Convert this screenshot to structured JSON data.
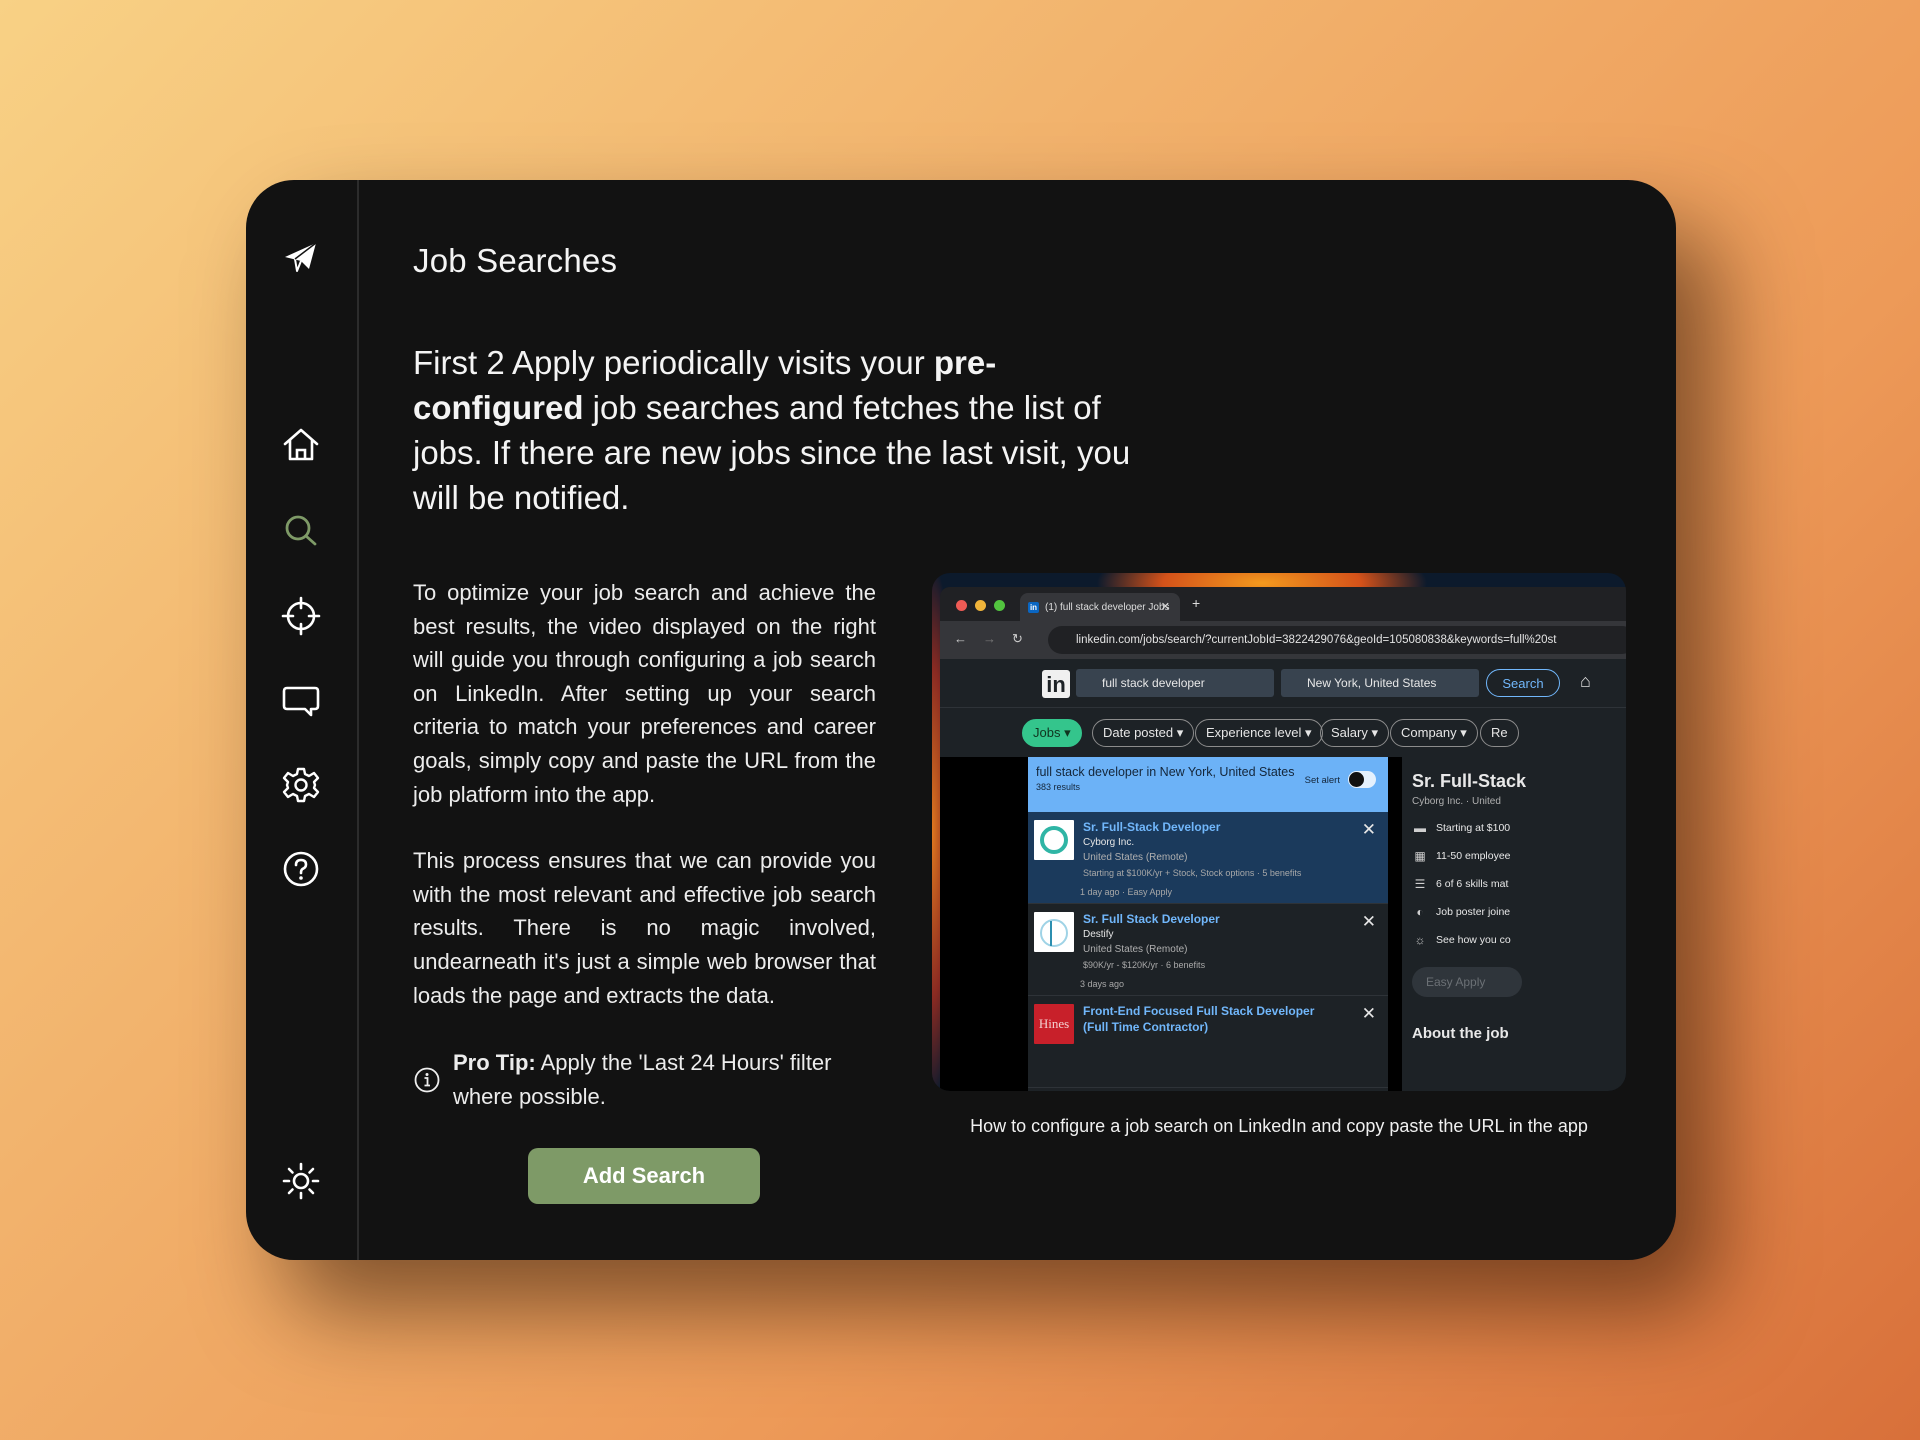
{
  "app": {
    "sidebar": {
      "logo_icon": "paper-plane-icon",
      "items": [
        {
          "name": "home",
          "icon": "home-icon",
          "active": false
        },
        {
          "name": "search",
          "icon": "search-icon",
          "active": true
        },
        {
          "name": "targets",
          "icon": "crosshair-icon",
          "active": false
        },
        {
          "name": "feedback",
          "icon": "chat-bubble-icon",
          "active": false
        },
        {
          "name": "settings",
          "icon": "gear-icon",
          "active": false
        },
        {
          "name": "help",
          "icon": "help-circle-icon",
          "active": false
        }
      ],
      "theme_toggle_icon": "sun-icon"
    },
    "colors": {
      "accent": "#7e9a67",
      "window_bg": "#121212",
      "text": "#f2f2f2"
    }
  },
  "page": {
    "title": "Job Searches",
    "lead": {
      "part1": "First 2 Apply periodically visits your ",
      "bold": "pre-configured",
      "part2": " job searches and fetches the list of jobs. If there are new jobs since the last visit, you will be notified."
    },
    "paragraphs": [
      "To optimize your job search and achieve the best results, the video displayed on the right will guide you through configuring a job search on LinkedIn. After setting up your search criteria to match your preferences and career goals, simply copy and paste the URL from the job platform into the app.",
      "This process ensures that we can provide you with the most relevant and effective job search results. There is no magic involved, undearneath it's just a simple web browser that loads the page and extracts the data."
    ],
    "tip": {
      "icon": "info-icon",
      "label": "Pro Tip:",
      "text": " Apply the 'Last 24 Hours' filter where possible."
    },
    "add_button": "Add Search",
    "video": {
      "caption": "How to configure a job search on LinkedIn and copy paste the URL in the app",
      "browser": {
        "tab_title": "(1) full stack developer Jobs",
        "url": "linkedin.com/jobs/search/?currentJobId=3822429076&geoId=105080838&keywords=full%20st"
      },
      "linkedin": {
        "search_value": "full stack developer",
        "location_value": "New York, United States",
        "search_button": "Search",
        "filters": [
          "Jobs",
          "Date posted",
          "Experience level",
          "Salary",
          "Company",
          "Re"
        ],
        "results_query": "full stack developer in New York, United States",
        "results_count": "383 results",
        "set_alert": "Set alert",
        "jobs": [
          {
            "title": "Sr. Full-Stack Developer",
            "company": "Cyborg Inc.",
            "location": "United States (Remote)",
            "salary": "Starting at $100K/yr + Stock, Stock options · 5 benefits",
            "meta": "1 day ago · Easy Apply"
          },
          {
            "title": "Sr. Full Stack Developer",
            "company": "Destify",
            "location": "United States (Remote)",
            "salary": "$90K/yr - $120K/yr · 6 benefits",
            "meta": "3 days ago"
          },
          {
            "title": "Front-End Focused Full Stack Developer (Full Time Contractor)",
            "company_logo_text": "Hines"
          }
        ],
        "detail": {
          "title": "Sr. Full-Stack",
          "subtitle": "Cyborg Inc. · United",
          "rows": [
            "Starting at $100",
            "11-50 employee",
            "6 of 6 skills mat",
            "Job poster joine",
            "See how you co"
          ],
          "easy_apply": "Easy Apply",
          "about": "About the job"
        }
      }
    }
  }
}
